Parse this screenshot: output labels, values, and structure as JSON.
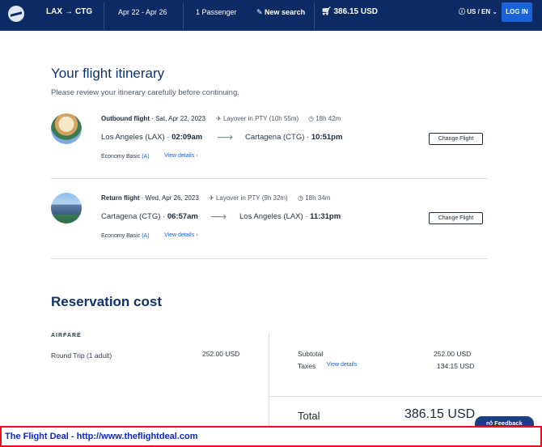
{
  "header": {
    "origin": "LAX",
    "destination": "CTG",
    "route_arrow": "→",
    "dates": "Apr 22 - Apr 26",
    "passengers": "1 Passenger",
    "new_search": "New search",
    "total": "386.15 USD",
    "locale": "US / EN",
    "login": "LOG IN"
  },
  "itinerary": {
    "title": "Your flight itinerary",
    "subtitle": "Please review your itinerary carefully before continuing."
  },
  "flights": [
    {
      "label": "Outbound flight",
      "date": "Sat, Apr 22, 2023",
      "layover": "Layover in PTY (10h 55m)",
      "duration": "18h 42m",
      "from_city": "Los Angeles (LAX)",
      "from_time": "02:09am",
      "to_city": "Cartagena (CTG)",
      "to_time": "10:51pm",
      "fare_class": "Economy Basic",
      "fare_code": "(A)",
      "details_link": "View details",
      "change_button": "Change Flight"
    },
    {
      "label": "Return flight",
      "date": "Wed, Apr 26, 2023",
      "layover": "Layover in PTY (9h 32m)",
      "duration": "18h 34m",
      "from_city": "Cartagena (CTG)",
      "from_time": "06:57am",
      "to_city": "Los Angeles (LAX)",
      "to_time": "11:31pm",
      "fare_class": "Economy Basic",
      "fare_code": "(A)",
      "details_link": "View details",
      "change_button": "Change Flight"
    }
  ],
  "reservation": {
    "title": "Reservation cost",
    "airfare_label": "AIRFARE",
    "trip_type": "Round Trip",
    "trip_pax": "(1 adult)",
    "trip_price": "252.00 USD",
    "subtotal_label": "Subtotal",
    "subtotal_value": "252.00 USD",
    "taxes_label": "Taxes",
    "taxes_details": "View details",
    "taxes_value": "134.15 USD",
    "total_label": "Total",
    "total_value": "386.15 USD"
  },
  "feedback": "Feedback",
  "banner": "The Flight Deal - http://www.theflightdeal.com"
}
